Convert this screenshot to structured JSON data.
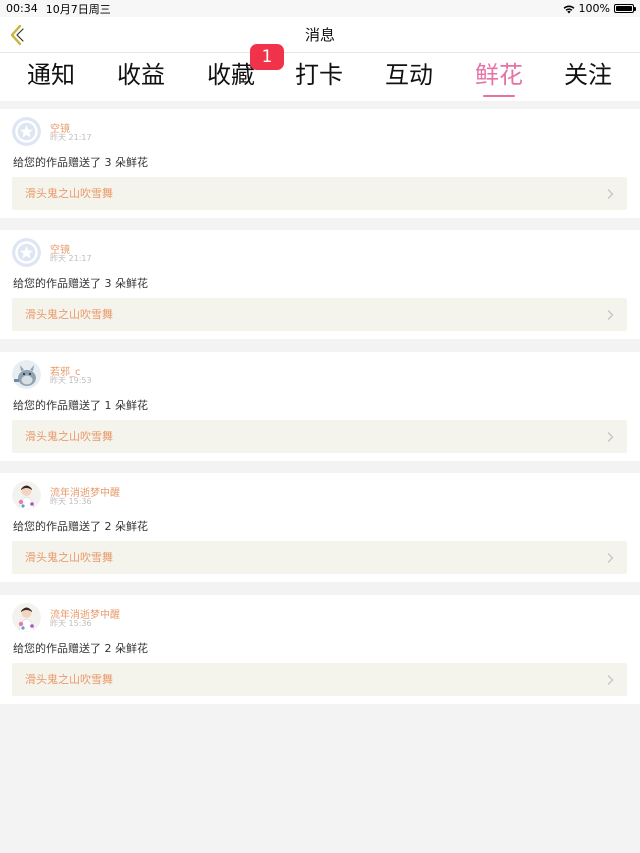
{
  "status_bar": {
    "time": "00:34",
    "date": "10月7日周三",
    "battery": "100%"
  },
  "nav": {
    "title": "消息",
    "back_icon": "chevron-left-icon"
  },
  "tabs": [
    {
      "label": "通知",
      "active": false
    },
    {
      "label": "收益",
      "active": false
    },
    {
      "label": "收藏",
      "active": false
    },
    {
      "label": "打卡",
      "active": false
    },
    {
      "label": "互动",
      "active": false
    },
    {
      "label": "鲜花",
      "active": true
    },
    {
      "label": "关注",
      "active": false
    }
  ],
  "badge": {
    "count": "1"
  },
  "notifications": [
    {
      "user": "空镜",
      "time": "昨天 21:17",
      "message": "给您的作品赠送了 3 朵鲜花",
      "work": "滑头鬼之山吹雪舞",
      "avatar": "star-avatar-icon"
    },
    {
      "user": "空镜",
      "time": "昨天 21:17",
      "message": "给您的作品赠送了 3 朵鲜花",
      "work": "滑头鬼之山吹雪舞",
      "avatar": "star-avatar-icon"
    },
    {
      "user": "若邪_c",
      "time": "昨天 19:53",
      "message": "给您的作品赠送了 1 朵鲜花",
      "work": "滑头鬼之山吹雪舞",
      "avatar": "totoro-avatar-icon"
    },
    {
      "user": "流年消逝梦中醒",
      "time": "昨天 15:36",
      "message": "给您的作品赠送了 2 朵鲜花",
      "work": "滑头鬼之山吹雪舞",
      "avatar": "person-avatar-icon"
    },
    {
      "user": "流年消逝梦中醒",
      "time": "昨天 15:36",
      "message": "给您的作品赠送了 2 朵鲜花",
      "work": "滑头鬼之山吹雪舞",
      "avatar": "person-avatar-icon"
    }
  ],
  "colors": {
    "accent": "#e573a4",
    "username": "#e89a6c",
    "badge": "#f0334a",
    "link_bg": "#f5f4ec",
    "page_bg": "#f3f3f3"
  }
}
